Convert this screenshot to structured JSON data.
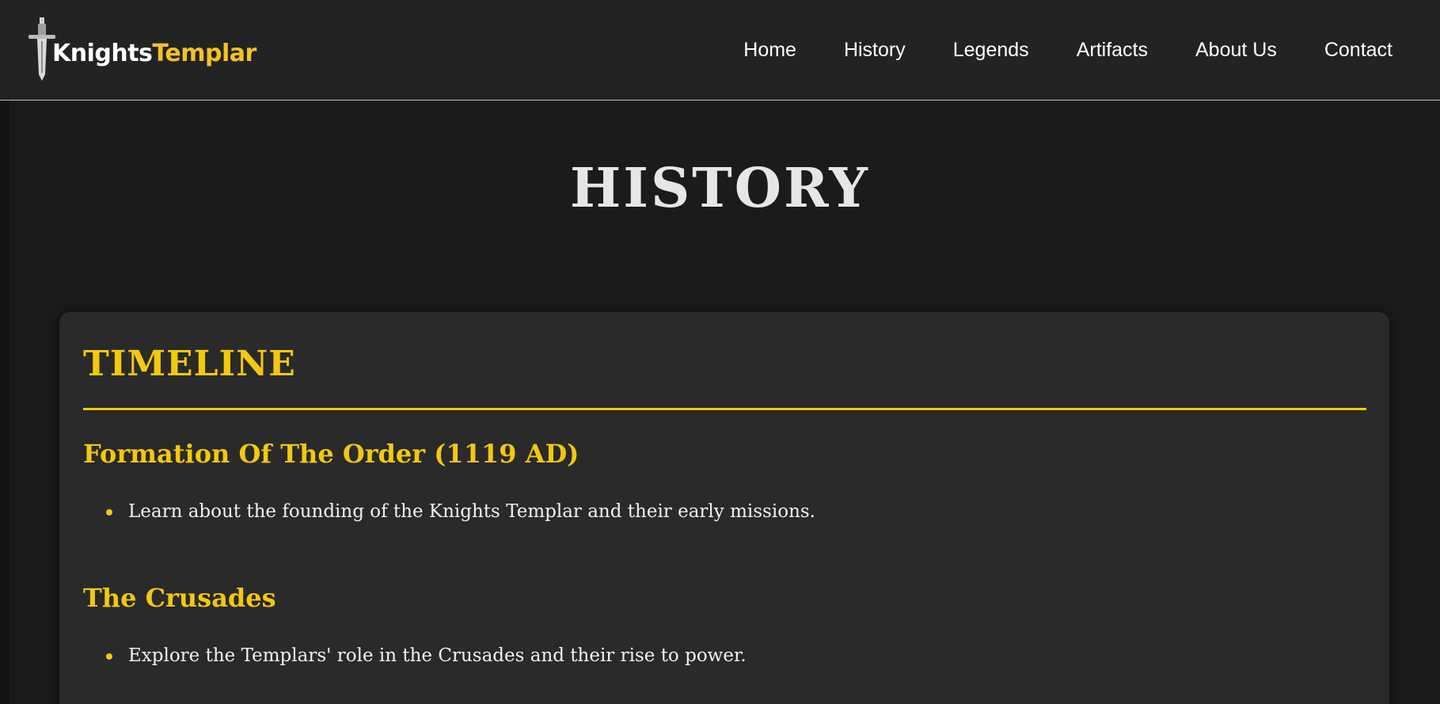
{
  "brand": {
    "name_part1": "Knights",
    "name_part2": "Templar",
    "icon": "sword-icon",
    "accent_color": "#f3c323"
  },
  "nav": {
    "items": [
      {
        "label": "Home"
      },
      {
        "label": "History"
      },
      {
        "label": "Legends"
      },
      {
        "label": "Artifacts"
      },
      {
        "label": "About Us"
      },
      {
        "label": "Contact"
      }
    ]
  },
  "page": {
    "title": "HISTORY"
  },
  "timeline": {
    "heading": "TIMELINE",
    "entries": [
      {
        "title": "Formation Of The Order (1119 AD)",
        "bullets": [
          "Learn about the founding of the Knights Templar and their early missions."
        ]
      },
      {
        "title": "The Crusades",
        "bullets": [
          "Explore the Templars' role in the Crusades and their rise to power."
        ]
      }
    ]
  },
  "colors": {
    "background": "#1b1b1b",
    "header": "#232323",
    "card": "#2a2a2a",
    "accent": "#f3c80f",
    "text": "#f0f0f0"
  }
}
